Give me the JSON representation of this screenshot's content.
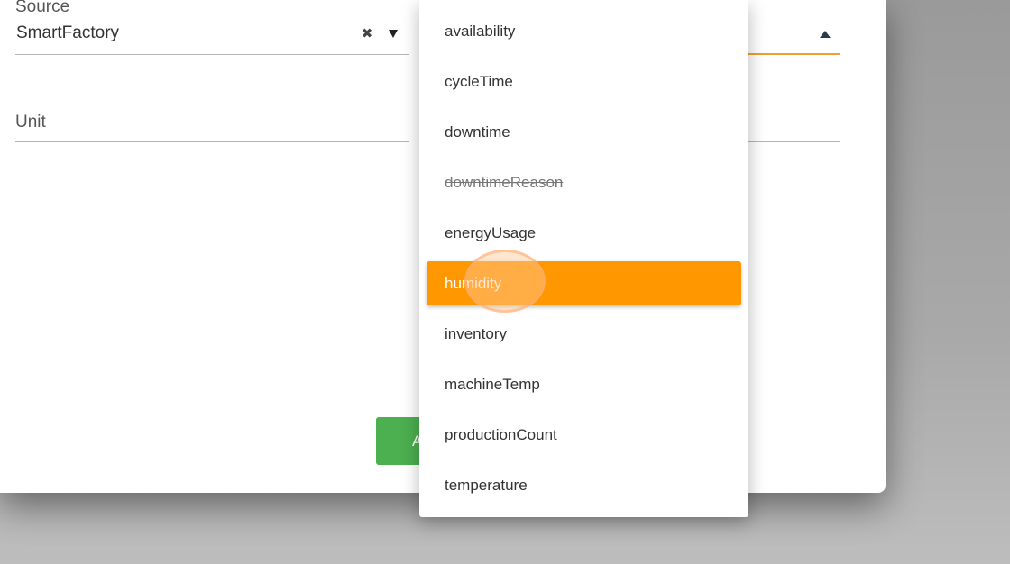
{
  "form": {
    "source_label": "Source",
    "source_value": "SmartFactory",
    "unit_label": "Unit",
    "clear_icon_glyph": "✖",
    "button_partial_label": "A"
  },
  "dropdown": {
    "options": [
      {
        "label": "availability",
        "state": "normal"
      },
      {
        "label": "cycleTime",
        "state": "normal"
      },
      {
        "label": "downtime",
        "state": "normal"
      },
      {
        "label": "downtimeReason",
        "state": "disabled"
      },
      {
        "label": "energyUsage",
        "state": "normal"
      },
      {
        "label": "humidity",
        "state": "highlighted"
      },
      {
        "label": "inventory",
        "state": "normal"
      },
      {
        "label": "machineTemp",
        "state": "normal"
      },
      {
        "label": "productionCount",
        "state": "normal"
      },
      {
        "label": "temperature",
        "state": "normal"
      }
    ]
  },
  "colors": {
    "accent": "#ff9800",
    "active_underline": "#f0a030",
    "button": "#4caf50"
  }
}
